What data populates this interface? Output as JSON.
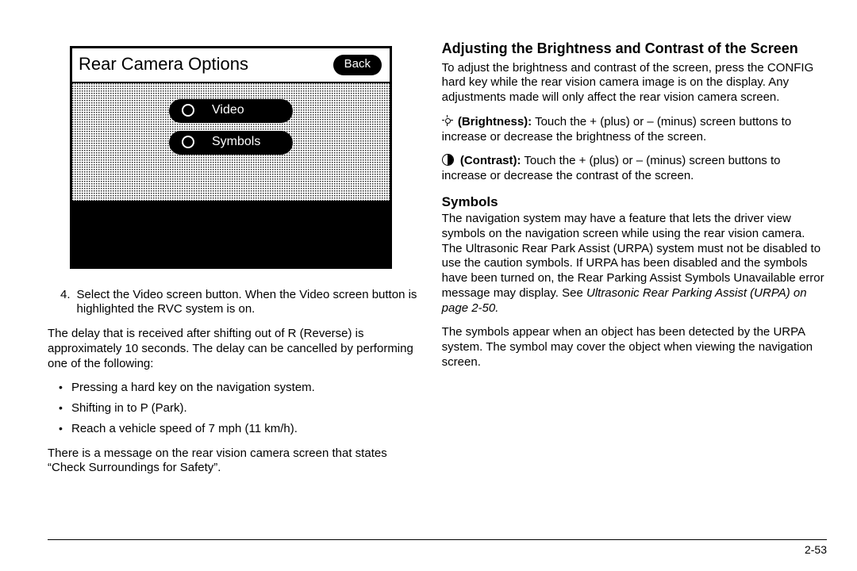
{
  "device": {
    "title": "Rear Camera Options",
    "back": "Back",
    "options": [
      {
        "label": "Video"
      },
      {
        "label": "Symbols"
      }
    ]
  },
  "left": {
    "step4_num": "4.",
    "step4": "Select the Video screen button. When the Video screen button is highlighted the RVC system is on.",
    "delay_para": "The delay that is received after shifting out of R (Reverse) is approximately 10 seconds. The delay can be cancelled by performing one of the following:",
    "bullets": [
      "Pressing a hard key on the navigation system.",
      "Shifting in to P (Park).",
      "Reach a vehicle speed of 7 mph (11 km/h)."
    ],
    "after_bullets": "There is a message on the rear vision camera screen that states “Check Surroundings for Safety”."
  },
  "right": {
    "h_brightness": "Adjusting the Brightness and Contrast of the Screen",
    "brightness_intro": "To adjust the brightness and contrast of the screen, press the CONFIG hard key while the rear vision camera image is on the display. Any adjustments made will only affect the rear vision camera screen.",
    "brightness_label": "(Brightness):",
    "brightness_text": "  Touch the + (plus) or – (minus) screen buttons to increase or decrease the brightness of the screen.",
    "contrast_label": "(Contrast):",
    "contrast_text": "  Touch the + (plus) or – (minus) screen buttons to increase or decrease the contrast of the screen.",
    "h_symbols": "Symbols",
    "symbols_para1a": "The navigation system may have a feature that lets the driver view symbols on the navigation screen while using the rear vision camera. The Ultrasonic Rear Park Assist (URPA) system must not be disabled to use the caution symbols. If URPA has been disabled and the symbols have been turned on, the Rear Parking Assist Symbols Unavailable error message may display. See ",
    "symbols_para1b": "Ultrasonic Rear Parking Assist (URPA) on page 2‑50.",
    "symbols_para2": "The symbols appear when an object has been detected by the URPA system. The symbol may cover the object when viewing the navigation screen."
  },
  "page_number": "2-53"
}
